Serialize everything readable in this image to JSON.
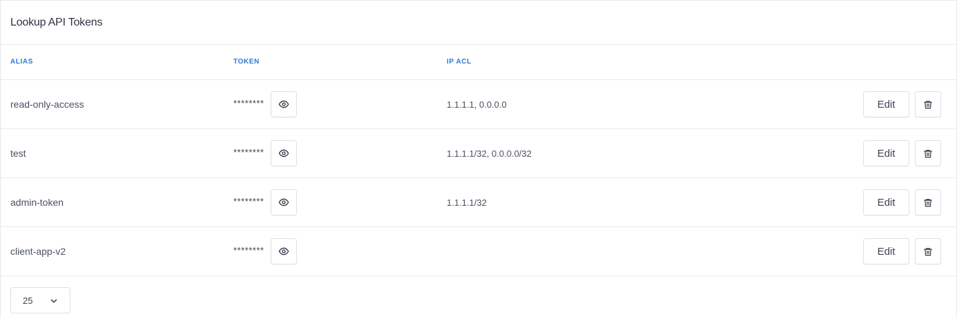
{
  "header": {
    "title": "Lookup API Tokens"
  },
  "columns": {
    "alias": "ALIAS",
    "token": "TOKEN",
    "ip_acl": "IP ACL"
  },
  "rows": [
    {
      "alias": "read-only-access",
      "token_masked": "********",
      "ip_acl": "1.1.1.1, 0.0.0.0",
      "edit_label": "Edit"
    },
    {
      "alias": "test",
      "token_masked": "********",
      "ip_acl": "1.1.1.1/32, 0.0.0.0/32",
      "edit_label": "Edit"
    },
    {
      "alias": "admin-token",
      "token_masked": "********",
      "ip_acl": "1.1.1.1/32",
      "edit_label": "Edit"
    },
    {
      "alias": "client-app-v2",
      "token_masked": "********",
      "ip_acl": "",
      "edit_label": "Edit"
    }
  ],
  "pagination": {
    "page_size": "25"
  },
  "icons": {
    "reveal": "eye-icon",
    "delete": "trash-icon",
    "dropdown": "chevron-down-icon"
  },
  "colors": {
    "header_accent": "#2b78d6",
    "border": "#dcdfe5",
    "text": "#3b4252"
  }
}
